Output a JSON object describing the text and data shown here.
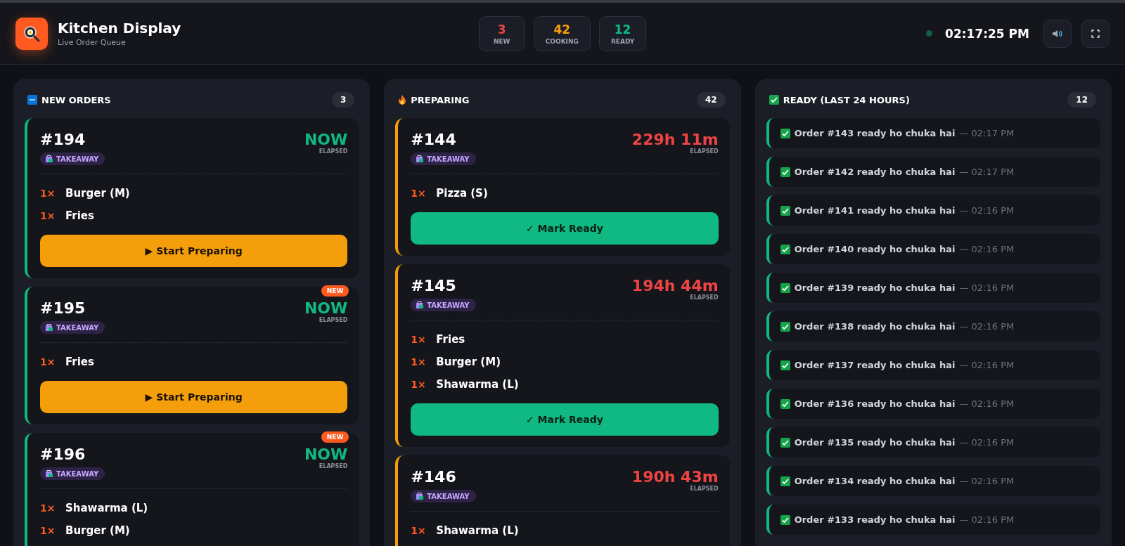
{
  "header": {
    "title": "Kitchen Display",
    "subtitle": "Live Order Queue",
    "stats": [
      {
        "value": "3",
        "label": "NEW",
        "color": "#ef4444"
      },
      {
        "value": "42",
        "label": "COOKING",
        "color": "#f59e0b"
      },
      {
        "value": "12",
        "label": "READY",
        "color": "#10b981"
      }
    ],
    "clock": "02:17:25 PM",
    "online": true
  },
  "columns": [
    {
      "kind": "new",
      "title": "NEW ORDERS",
      "count": "3",
      "orders": [
        {
          "number": "#194",
          "type": "TAKEAWAY",
          "elapsed": "NOW",
          "elapsed_label": "ELAPSED",
          "late": false,
          "items": [
            {
              "qty": "1×",
              "name": "Burger (M)"
            },
            {
              "qty": "1×",
              "name": "Fries"
            }
          ],
          "action": "▶ Start Preparing"
        },
        {
          "number": "#195",
          "type": "TAKEAWAY",
          "elapsed": "NOW",
          "elapsed_label": "ELAPSED",
          "late": false,
          "badge": "NEW",
          "items": [
            {
              "qty": "1×",
              "name": "Fries"
            }
          ],
          "action": "▶ Start Preparing"
        },
        {
          "number": "#196",
          "type": "TAKEAWAY",
          "elapsed": "NOW",
          "elapsed_label": "ELAPSED",
          "late": false,
          "badge": "NEW",
          "items": [
            {
              "qty": "1×",
              "name": "Shawarma (L)"
            },
            {
              "qty": "1×",
              "name": "Burger (M)"
            }
          ]
        }
      ]
    },
    {
      "kind": "preparing",
      "title": "PREPARING",
      "count": "42",
      "orders": [
        {
          "number": "#144",
          "type": "TAKEAWAY",
          "elapsed": "229h 11m",
          "elapsed_label": "ELAPSED",
          "late": true,
          "items": [
            {
              "qty": "1×",
              "name": "Pizza (S)"
            }
          ],
          "action": "✓ Mark Ready"
        },
        {
          "number": "#145",
          "type": "TAKEAWAY",
          "elapsed": "194h 44m",
          "elapsed_label": "ELAPSED",
          "late": true,
          "items": [
            {
              "qty": "1×",
              "name": "Fries"
            },
            {
              "qty": "1×",
              "name": "Burger (M)"
            },
            {
              "qty": "1×",
              "name": "Shawarma (L)"
            }
          ],
          "action": "✓ Mark Ready"
        },
        {
          "number": "#146",
          "type": "TAKEAWAY",
          "elapsed": "190h 43m",
          "elapsed_label": "ELAPSED",
          "late": true,
          "items": [
            {
              "qty": "1×",
              "name": "Shawarma (L)"
            }
          ]
        }
      ]
    },
    {
      "kind": "ready",
      "title": "READY (LAST 24 HOURS)",
      "count": "12",
      "entries": [
        {
          "message": "Order #143 ready ho chuka hai",
          "time": "— 02:17 PM"
        },
        {
          "message": "Order #142 ready ho chuka hai",
          "time": "— 02:17 PM"
        },
        {
          "message": "Order #141 ready ho chuka hai",
          "time": "— 02:16 PM"
        },
        {
          "message": "Order #140 ready ho chuka hai",
          "time": "— 02:16 PM"
        },
        {
          "message": "Order #139 ready ho chuka hai",
          "time": "— 02:16 PM"
        },
        {
          "message": "Order #138 ready ho chuka hai",
          "time": "— 02:16 PM"
        },
        {
          "message": "Order #137 ready ho chuka hai",
          "time": "— 02:16 PM"
        },
        {
          "message": "Order #136 ready ho chuka hai",
          "time": "— 02:16 PM"
        },
        {
          "message": "Order #135 ready ho chuka hai",
          "time": "— 02:16 PM"
        },
        {
          "message": "Order #134 ready ho chuka hai",
          "time": "— 02:16 PM"
        },
        {
          "message": "Order #133 ready ho chuka hai",
          "time": "— 02:16 PM"
        }
      ]
    }
  ]
}
